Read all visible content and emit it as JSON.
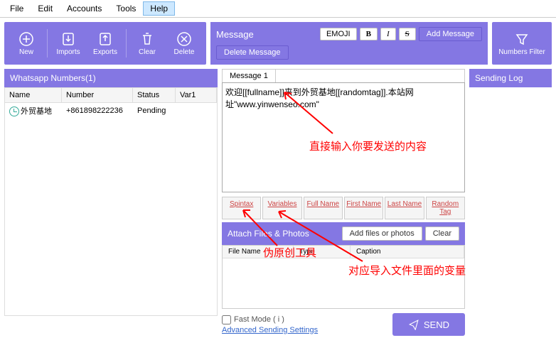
{
  "menu": {
    "items": [
      "File",
      "Edit",
      "Accounts",
      "Tools",
      "Help"
    ],
    "active": 4
  },
  "toolbar": {
    "new": "New",
    "imports": "Imports",
    "exports": "Exports",
    "clear": "Clear",
    "delete": "Delete",
    "numfilter": "Numbers Filter"
  },
  "numbers": {
    "title": "Whatsapp Numbers(1)",
    "cols": {
      "name": "Name",
      "number": "Number",
      "status": "Status",
      "var1": "Var1"
    },
    "rows": [
      {
        "name": "外贸基地",
        "number": "+861898222236",
        "status": "Pending",
        "var1": ""
      }
    ]
  },
  "message": {
    "title": "Message",
    "emoji": "EMOJI",
    "bold": "B",
    "italic": "I",
    "strike": "S",
    "add": "Add Message",
    "del": "Delete Message",
    "tab": "Message 1",
    "text": "欢迎[[fullname]]来到外贸基地[[randomtag]].本站网址\"www.yinwenseo.com\"",
    "btns": {
      "spintax": "Spintax",
      "variables": "Variables",
      "fullname": "Full Name",
      "firstname": "First Name",
      "lastname": "Last Name",
      "randomtag": "Random Tag"
    }
  },
  "attach": {
    "title": "Attach Files & Photos",
    "add": "Add files or photos",
    "clear": "Clear",
    "cols": {
      "file": "File Name",
      "type": "Type",
      "caption": "Caption"
    }
  },
  "bottom": {
    "fast": "Fast Mode ( i )",
    "adv": "Advanced Sending Settings",
    "send": "SEND"
  },
  "log": {
    "title": "Sending Log"
  },
  "anno": {
    "a1": "直接输入你要发送的内容",
    "a2": "伪原创工具",
    "a3": "对应导入文件里面的变量"
  }
}
